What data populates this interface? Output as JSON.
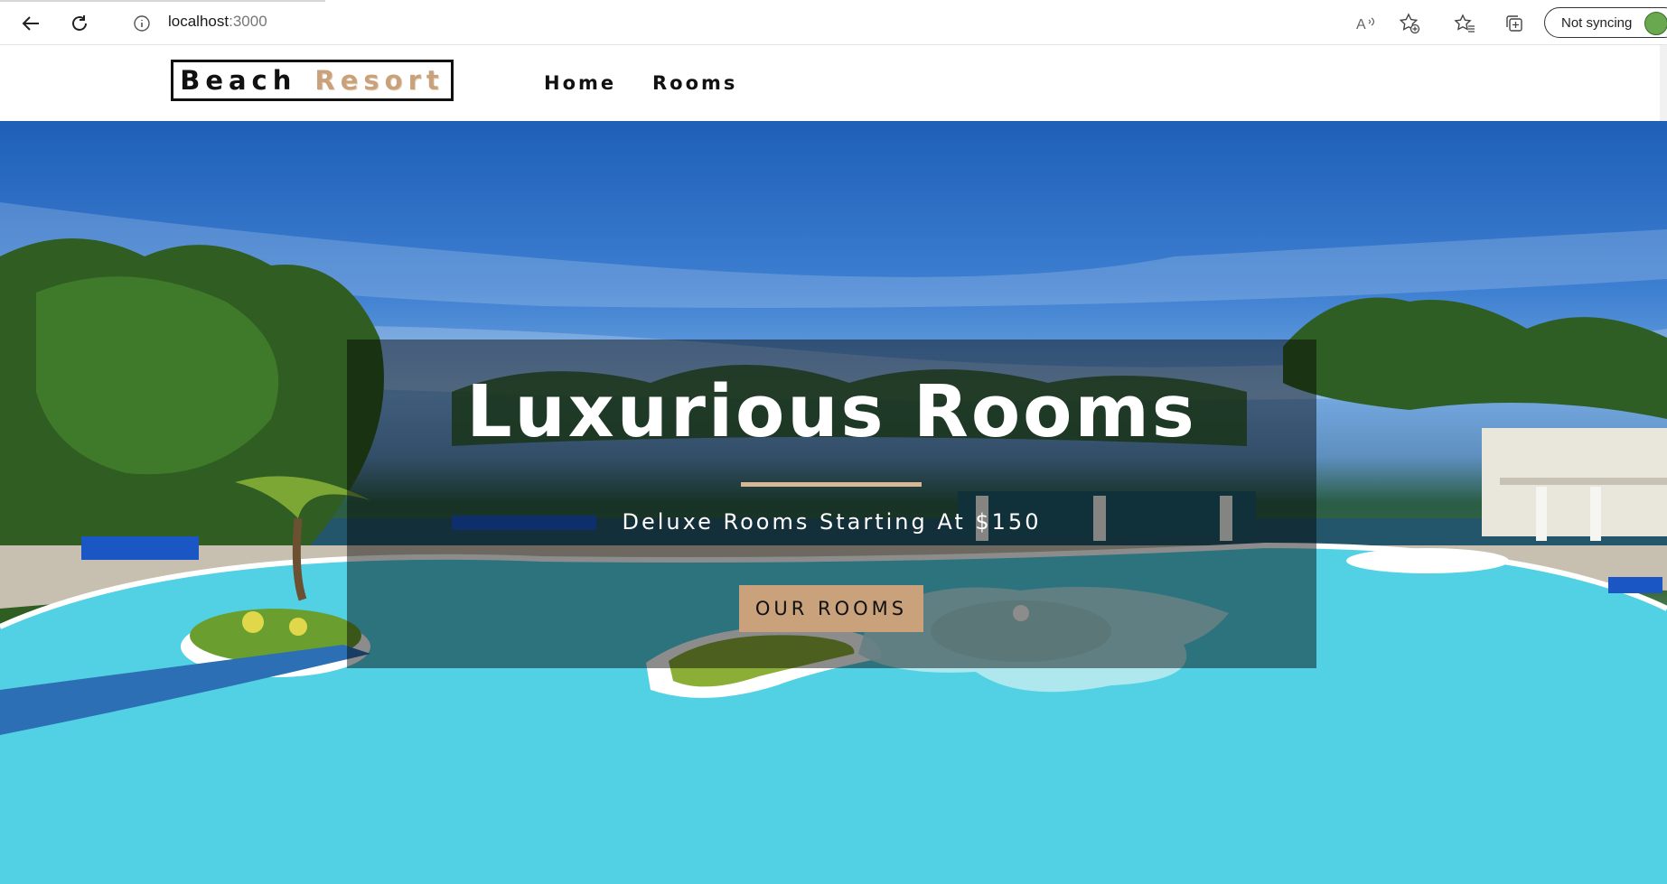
{
  "browser": {
    "url_host": "localhost",
    "url_port": ":3000",
    "sync_label": "Not syncing",
    "icons": [
      "back-arrow-icon",
      "refresh-icon",
      "info-icon",
      "read-aloud-icon",
      "add-favorite-icon",
      "favorites-icon",
      "collections-icon",
      "profile-avatar-icon"
    ]
  },
  "site": {
    "logo_word1": "Beach",
    "logo_word2": "Resort",
    "nav": {
      "home": "Home",
      "rooms": "Rooms"
    }
  },
  "hero": {
    "title": "Luxurious Rooms",
    "subtitle": "Deluxe Rooms Starting At $150",
    "button": "OUR ROOMS"
  },
  "colors": {
    "accent": "#c9a27c",
    "underline": "#d9b995",
    "banner_overlay": "rgba(0,0,0,0.45)",
    "text_dark": "#111111"
  }
}
